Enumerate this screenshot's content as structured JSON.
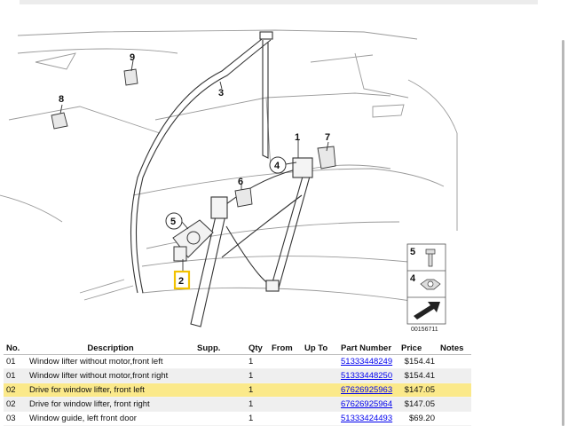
{
  "diagram": {
    "image_number": "00156711",
    "callouts": {
      "c1": "1",
      "c2": "2",
      "c3": "3",
      "c4": "4",
      "c5": "5",
      "c6": "6",
      "c7": "7",
      "c8": "8",
      "c9": "9",
      "legend_5": "5",
      "legend_4": "4"
    },
    "highlighted_callout": "2"
  },
  "table": {
    "headers": {
      "no": "No.",
      "description": "Description",
      "supp": "Supp.",
      "qty": "Qty",
      "from": "From",
      "up_to": "Up To",
      "part_number": "Part Number",
      "price": "Price",
      "notes": "Notes"
    },
    "rows": [
      {
        "no": "01",
        "description": "Window lifter without motor,front left",
        "supp": "",
        "qty": "1",
        "from": "",
        "up_to": "",
        "part_number": "51333448249",
        "price": "$154.41",
        "notes": ""
      },
      {
        "no": "01",
        "description": "Window lifter without motor,front right",
        "supp": "",
        "qty": "1",
        "from": "",
        "up_to": "",
        "part_number": "51333448250",
        "price": "$154.41",
        "notes": ""
      },
      {
        "no": "02",
        "description": "Drive for window lifter, front left",
        "supp": "",
        "qty": "1",
        "from": "",
        "up_to": "",
        "part_number": "67626925963",
        "price": "$147.05",
        "notes": ""
      },
      {
        "no": "02",
        "description": "Drive for window lifter, front right",
        "supp": "",
        "qty": "1",
        "from": "",
        "up_to": "",
        "part_number": "67626925964",
        "price": "$147.05",
        "notes": ""
      },
      {
        "no": "03",
        "description": "Window guide, left front door",
        "supp": "",
        "qty": "1",
        "from": "",
        "up_to": "",
        "part_number": "51333424493",
        "price": "$69.20",
        "notes": ""
      }
    ],
    "highlight_color": "#fbe98a",
    "link_color": "#0000ee"
  }
}
